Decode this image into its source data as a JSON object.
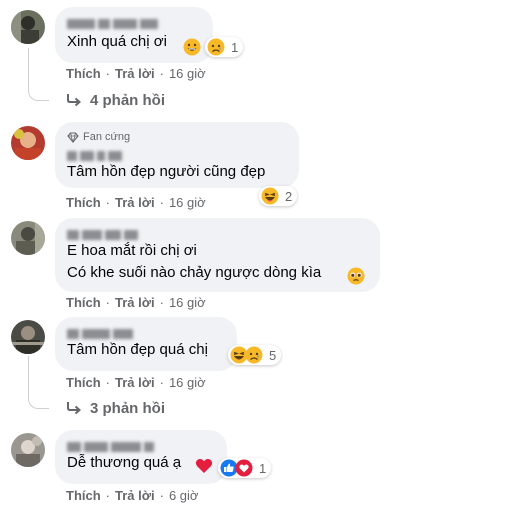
{
  "comments": [
    {
      "text": "Xinh quá chị ơi",
      "reaction_count": "1",
      "actions": {
        "like": "Thích",
        "reply": "Trả lời",
        "time": "16 giờ"
      },
      "replies_label": "4 phản hồi"
    },
    {
      "badge": "Fan cứng",
      "text": "Tâm hồn đẹp người cũng đẹp",
      "reaction_count": "2",
      "actions": {
        "like": "Thích",
        "reply": "Trả lời",
        "time": "16 giờ"
      }
    },
    {
      "text_line1": "E hoa mắt rồi chị ơi",
      "text_line2": "Có khe suối nào chảy ngược dòng kìa",
      "actions": {
        "like": "Thích",
        "reply": "Trả lời",
        "time": "16 giờ"
      }
    },
    {
      "text": "Tâm hồn đẹp quá chị",
      "reaction_count": "5",
      "actions": {
        "like": "Thích",
        "reply": "Trả lời",
        "time": "16 giờ"
      },
      "replies_label": "3 phản hồi"
    },
    {
      "text": "Dễ thương quá ạ",
      "reaction_count": "1",
      "actions": {
        "like": "Thích",
        "reply": "Trả lời",
        "time": "6 giờ"
      }
    }
  ],
  "colors": {
    "bubble": "#f0f2f5",
    "meta_text": "#65676b",
    "body_text": "#050505",
    "like_blue": "#1877f2",
    "heart_red": "#e41e3f",
    "emoji_yellow": "#f7b928"
  },
  "icons": [
    "diamond-icon",
    "haha-emoji-icon",
    "sad-emoji-icon",
    "like-icon",
    "heart-emoji-icon",
    "grinning-emoji-icon",
    "pleading-emoji-icon",
    "reply-arrow-icon"
  ]
}
